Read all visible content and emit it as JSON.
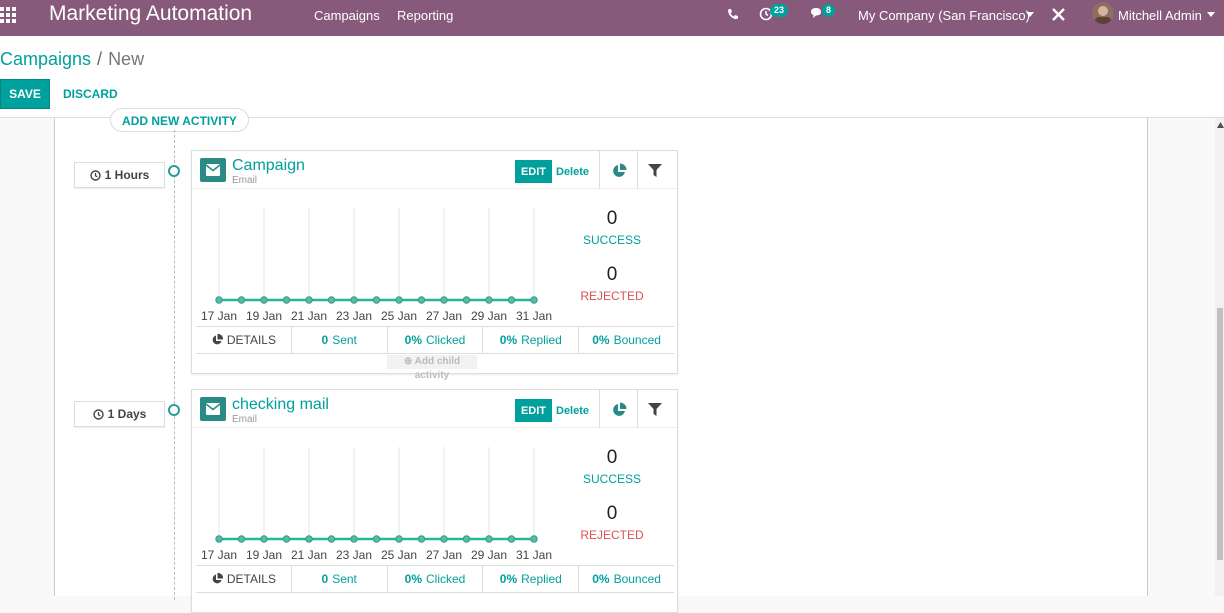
{
  "navbar": {
    "brand": "Marketing Automation",
    "menu": [
      "Campaigns",
      "Reporting"
    ],
    "activity_count": "23",
    "messages_count": "8",
    "company": "My Company (San Francisco)",
    "user": "Mitchell Admin"
  },
  "breadcrumb": {
    "parent": "Campaigns",
    "current": "New"
  },
  "buttons": {
    "save": "SAVE",
    "discard": "DISCARD",
    "add_activity": "ADD NEW ACTIVITY"
  },
  "activities": [
    {
      "trigger": "1 Hours",
      "title": "Campaign",
      "type": "Email",
      "edit": "EDIT",
      "delete": "Delete",
      "success": "0",
      "success_label": "SUCCESS",
      "rejected": "0",
      "rejected_label": "REJECTED",
      "footer": {
        "details": "DETAILS",
        "sent": "0",
        "sent_label": "Sent",
        "clicked": "0%",
        "clicked_label": "Clicked",
        "replied": "0%",
        "replied_label": "Replied",
        "bounced": "0%",
        "bounced_label": "Bounced"
      },
      "add_child": "Add child activity"
    },
    {
      "trigger": "1 Days",
      "title": "checking mail",
      "type": "Email",
      "edit": "EDIT",
      "delete": "Delete",
      "success": "0",
      "success_label": "SUCCESS",
      "rejected": "0",
      "rejected_label": "REJECTED",
      "footer": {
        "details": "DETAILS",
        "sent": "0",
        "sent_label": "Sent",
        "clicked": "0%",
        "clicked_label": "Clicked",
        "replied": "0%",
        "replied_label": "Replied",
        "bounced": "0%",
        "bounced_label": "Bounced"
      }
    }
  ],
  "chart_data": [
    {
      "type": "line",
      "x": [
        "17 Jan",
        "18 Jan",
        "19 Jan",
        "20 Jan",
        "21 Jan",
        "22 Jan",
        "23 Jan",
        "24 Jan",
        "25 Jan",
        "26 Jan",
        "27 Jan",
        "28 Jan",
        "29 Jan",
        "30 Jan",
        "31 Jan"
      ],
      "x_tick_labels": [
        "17 Jan",
        "19 Jan",
        "21 Jan",
        "23 Jan",
        "25 Jan",
        "27 Jan",
        "29 Jan",
        "31 Jan"
      ],
      "series": [
        {
          "values": [
            0,
            0,
            0,
            0,
            0,
            0,
            0,
            0,
            0,
            0,
            0,
            0,
            0,
            0,
            0
          ],
          "color": "#21b799"
        }
      ],
      "grid": "vertical"
    },
    {
      "type": "line",
      "x": [
        "17 Jan",
        "18 Jan",
        "19 Jan",
        "20 Jan",
        "21 Jan",
        "22 Jan",
        "23 Jan",
        "24 Jan",
        "25 Jan",
        "26 Jan",
        "27 Jan",
        "28 Jan",
        "29 Jan",
        "30 Jan",
        "31 Jan"
      ],
      "x_tick_labels": [
        "17 Jan",
        "19 Jan",
        "21 Jan",
        "23 Jan",
        "25 Jan",
        "27 Jan",
        "29 Jan",
        "31 Jan"
      ],
      "series": [
        {
          "values": [
            0,
            0,
            0,
            0,
            0,
            0,
            0,
            0,
            0,
            0,
            0,
            0,
            0,
            0,
            0
          ],
          "color": "#21b799"
        }
      ],
      "grid": "vertical"
    }
  ],
  "colors": {
    "navbar": "#875a7b",
    "accent": "#00a09d",
    "success": "#00a09d",
    "rejected": "#d9534f"
  }
}
